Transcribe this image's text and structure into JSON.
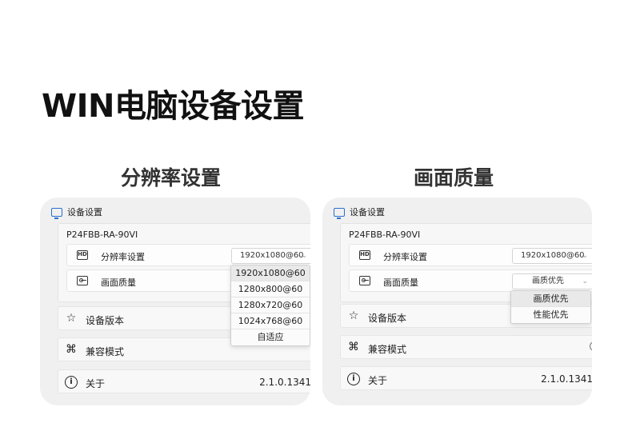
{
  "title": "WIN电脑设备设置",
  "sections": {
    "resolution": {
      "heading": "分辨率设置",
      "window_title": "设备设置",
      "device_name": "P24FBB-RA-90VI",
      "settings": {
        "resolution_label": "分辨率设置",
        "resolution_value": "1920x1080@60",
        "quality_label": "画面质量"
      },
      "dropdown_options": [
        "1920x1080@60",
        "1280x800@60",
        "1280x720@60",
        "1024x768@60",
        "自适应"
      ],
      "list": {
        "version_label": "设备版本",
        "compat_label": "兼容模式",
        "about_label": "关于",
        "about_value": "2.1.0.1341"
      }
    },
    "quality": {
      "heading": "画面质量",
      "window_title": "设备设置",
      "device_name": "P24FBB-RA-90VI",
      "settings": {
        "resolution_label": "分辨率设置",
        "resolution_value": "1920x1080@60",
        "quality_label": "画面质量",
        "quality_value": "画质优先"
      },
      "dropdown_options": [
        "画质优先",
        "性能优先"
      ],
      "list": {
        "version_label": "设备版本",
        "compat_label": "兼容模式",
        "about_label": "关于",
        "about_value": "2.1.0.1341"
      }
    }
  },
  "icons": {
    "monitor": "monitor-icon",
    "hd": "hd-icon",
    "image": "image-icon",
    "star": "star-icon",
    "command": "command-icon",
    "info": "info-icon"
  },
  "colors": {
    "accent": "#2b6fd0",
    "panel_bg": "#f0f0f0"
  }
}
